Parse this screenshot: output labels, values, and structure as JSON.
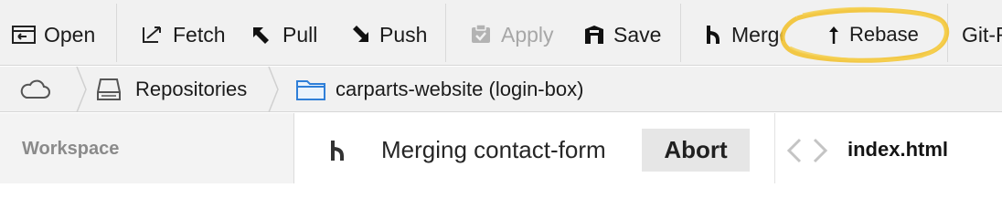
{
  "toolbar": {
    "open_label": "Open",
    "fetch_label": "Fetch",
    "pull_label": "Pull",
    "push_label": "Push",
    "apply_label": "Apply",
    "save_label": "Save",
    "merge_label": "Merge",
    "rebase_label": "Rebase",
    "gitflow_label": "Git-Flow"
  },
  "breadcrumb": {
    "repositories_label": "Repositories",
    "repo_label": "carparts-website (login-box)"
  },
  "sidebar": {
    "title": "Workspace"
  },
  "merge_banner": {
    "text": "Merging contact-form",
    "abort_label": "Abort"
  },
  "file_view": {
    "filename": "index.html"
  },
  "colors": {
    "toolbar_bg": "#f1f1f1",
    "highlight": "#f2c232",
    "folder_icon": "#2f7fd8",
    "disabled_text": "#a7a7a7"
  },
  "icons": [
    "open-icon",
    "fetch-icon",
    "pull-icon",
    "push-icon",
    "apply-icon",
    "save-icon",
    "merge-icon",
    "rebase-icon",
    "cloud-icon",
    "drive-icon",
    "folder-icon",
    "code-icon"
  ]
}
